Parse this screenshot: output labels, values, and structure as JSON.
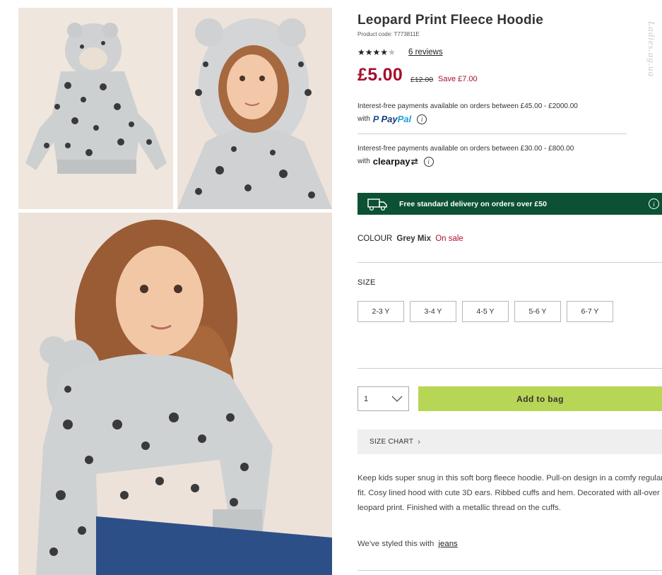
{
  "gallery": {
    "thumb1_alt": "Leopard print fleece hoodie flat lay",
    "thumb2_alt": "Girl wearing hoodie with hood up",
    "main_alt": "Girl wearing leopard print fleece hoodie"
  },
  "product": {
    "title": "Leopard Print Fleece Hoodie",
    "code": "Product code: T773811E",
    "rating": 4,
    "rating_max": 5,
    "reviews": "6 reviews",
    "price": "£5.00",
    "was_price": "£12.00",
    "save": "Save £7.00"
  },
  "payments": {
    "paypal_text": "Interest-free payments available on orders between £45.00 - £2000.00",
    "paypal_with": "with",
    "paypal_logo_p": "P",
    "paypal_logo_pay": "Pay",
    "paypal_logo_pal": "Pal",
    "clearpay_text": "Interest-free payments available on orders between £30.00 - £800.00",
    "clearpay_with": "with",
    "clearpay_logo": "clearpay",
    "info_glyph": "i"
  },
  "delivery": {
    "text": "Free standard delivery on orders over £50",
    "info_glyph": "i",
    "bg_color": "#0c5134"
  },
  "colour": {
    "label": "COLOUR",
    "value": "Grey Mix",
    "status": "On sale"
  },
  "size": {
    "label": "SIZE",
    "options": [
      "2-3 Y",
      "3-4 Y",
      "4-5 Y",
      "5-6 Y",
      "6-7 Y"
    ]
  },
  "purchase": {
    "quantity": "1",
    "add_to_bag": "Add to bag",
    "add_color": "#b8d656"
  },
  "size_chart": {
    "label": "SIZE CHART",
    "chevron": "›"
  },
  "description": {
    "text": "Keep kids super snug in this soft borg fleece hoodie. Pull-on design in a comfy regular fit. Cosy lined hood with cute 3D ears. Ribbed cuffs and hem. Decorated with all-over leopard print. Finished with a metallic thread on the cuffs.",
    "styled_prefix": "We've styled this with",
    "styled_link": "jeans"
  },
  "watermark": "Ladies.ag.ua",
  "colors": {
    "price_red": "#a50f2d",
    "sale_red": "#b0102f"
  }
}
